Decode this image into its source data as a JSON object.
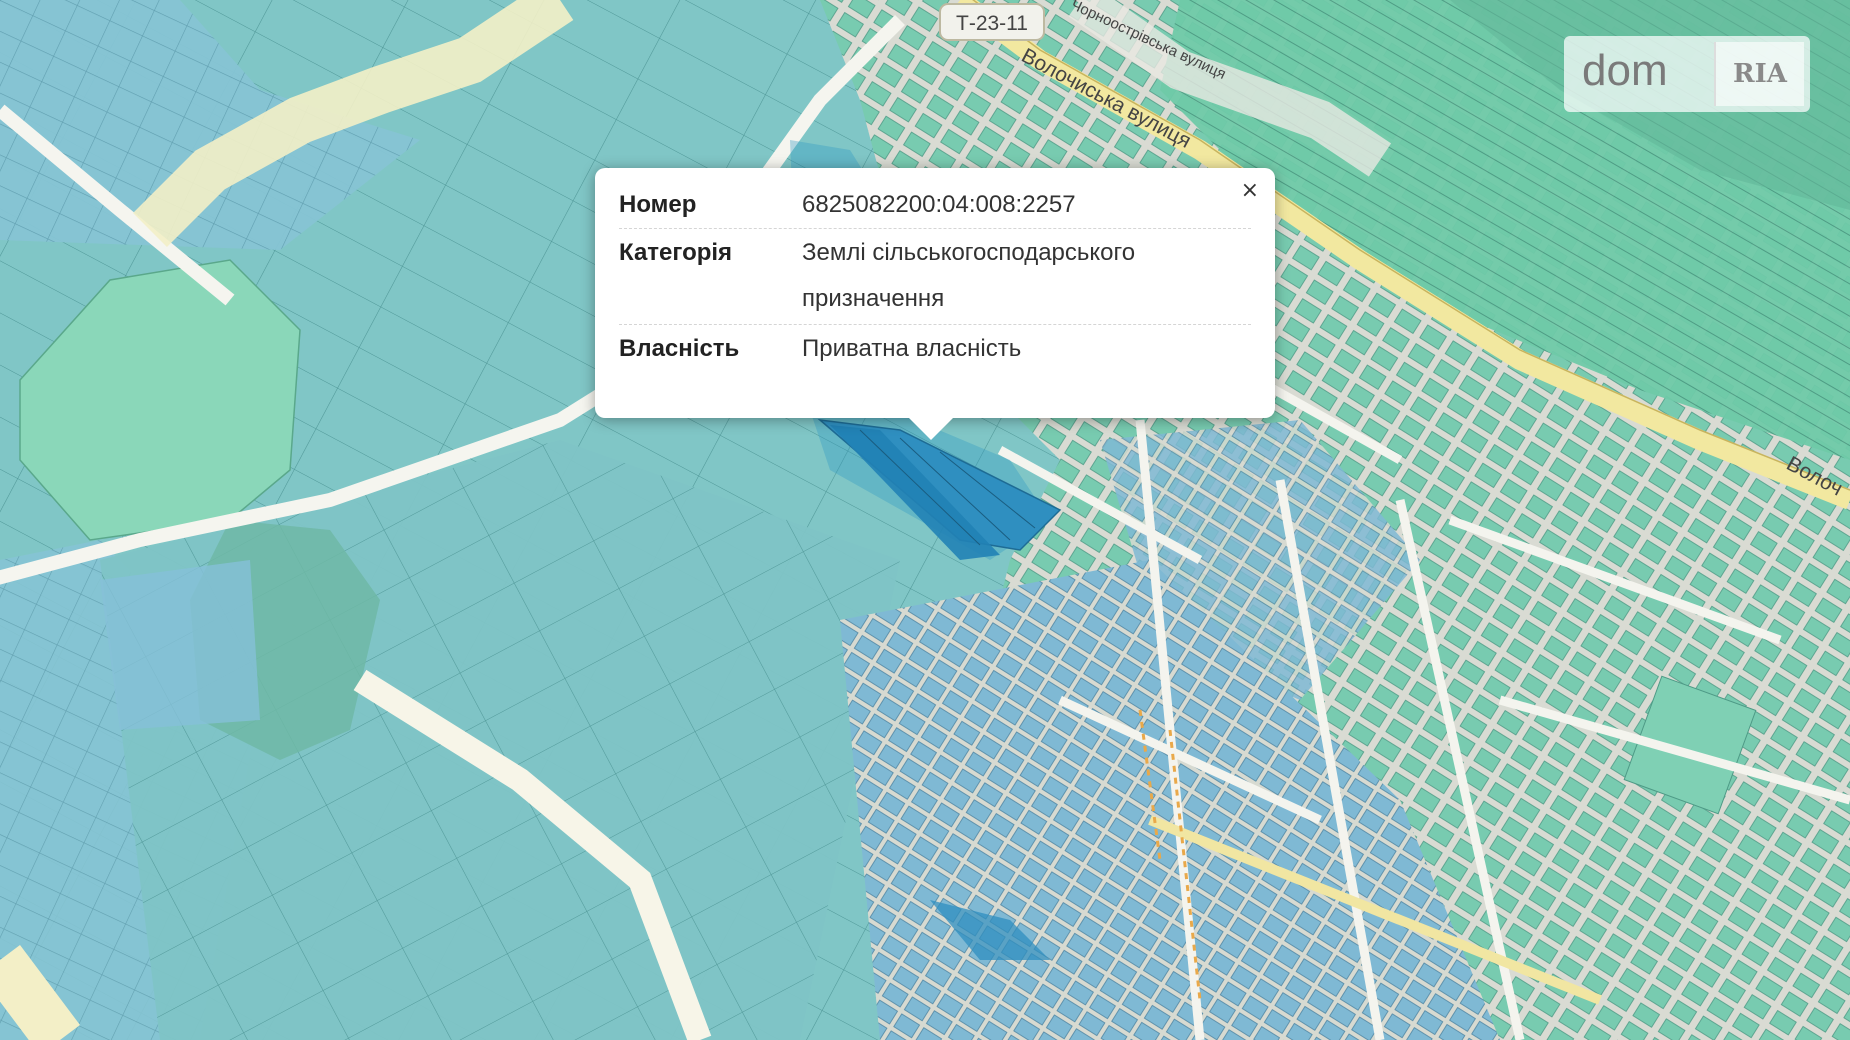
{
  "map": {
    "road_badge": "Т-23-11",
    "street_labels": {
      "volochyska_top": "Волочиська вулиця",
      "chornoostrivska": "Чорноострівська вулиця",
      "volochyska_right": "Волоч"
    }
  },
  "popup": {
    "close_glyph": "×",
    "rows": [
      {
        "label": "Номер",
        "value": "6825082200:04:008:2257"
      },
      {
        "label": "Категорія",
        "value_line1": "Землі сільськогосподарського",
        "value_line2": "призначення"
      },
      {
        "label": "Власність",
        "value": "Приватна власність"
      }
    ]
  },
  "watermark": {
    "left": "dom",
    "right": "RIA"
  },
  "colors": {
    "parcel_blue": "#86c3d3",
    "parcel_teal": "#7fc7c4",
    "parcel_green": "#7ed6b4",
    "selected": "#2b95c6",
    "road_yellow": "#f3edb4",
    "urban_bg": "#dcdcd6"
  }
}
